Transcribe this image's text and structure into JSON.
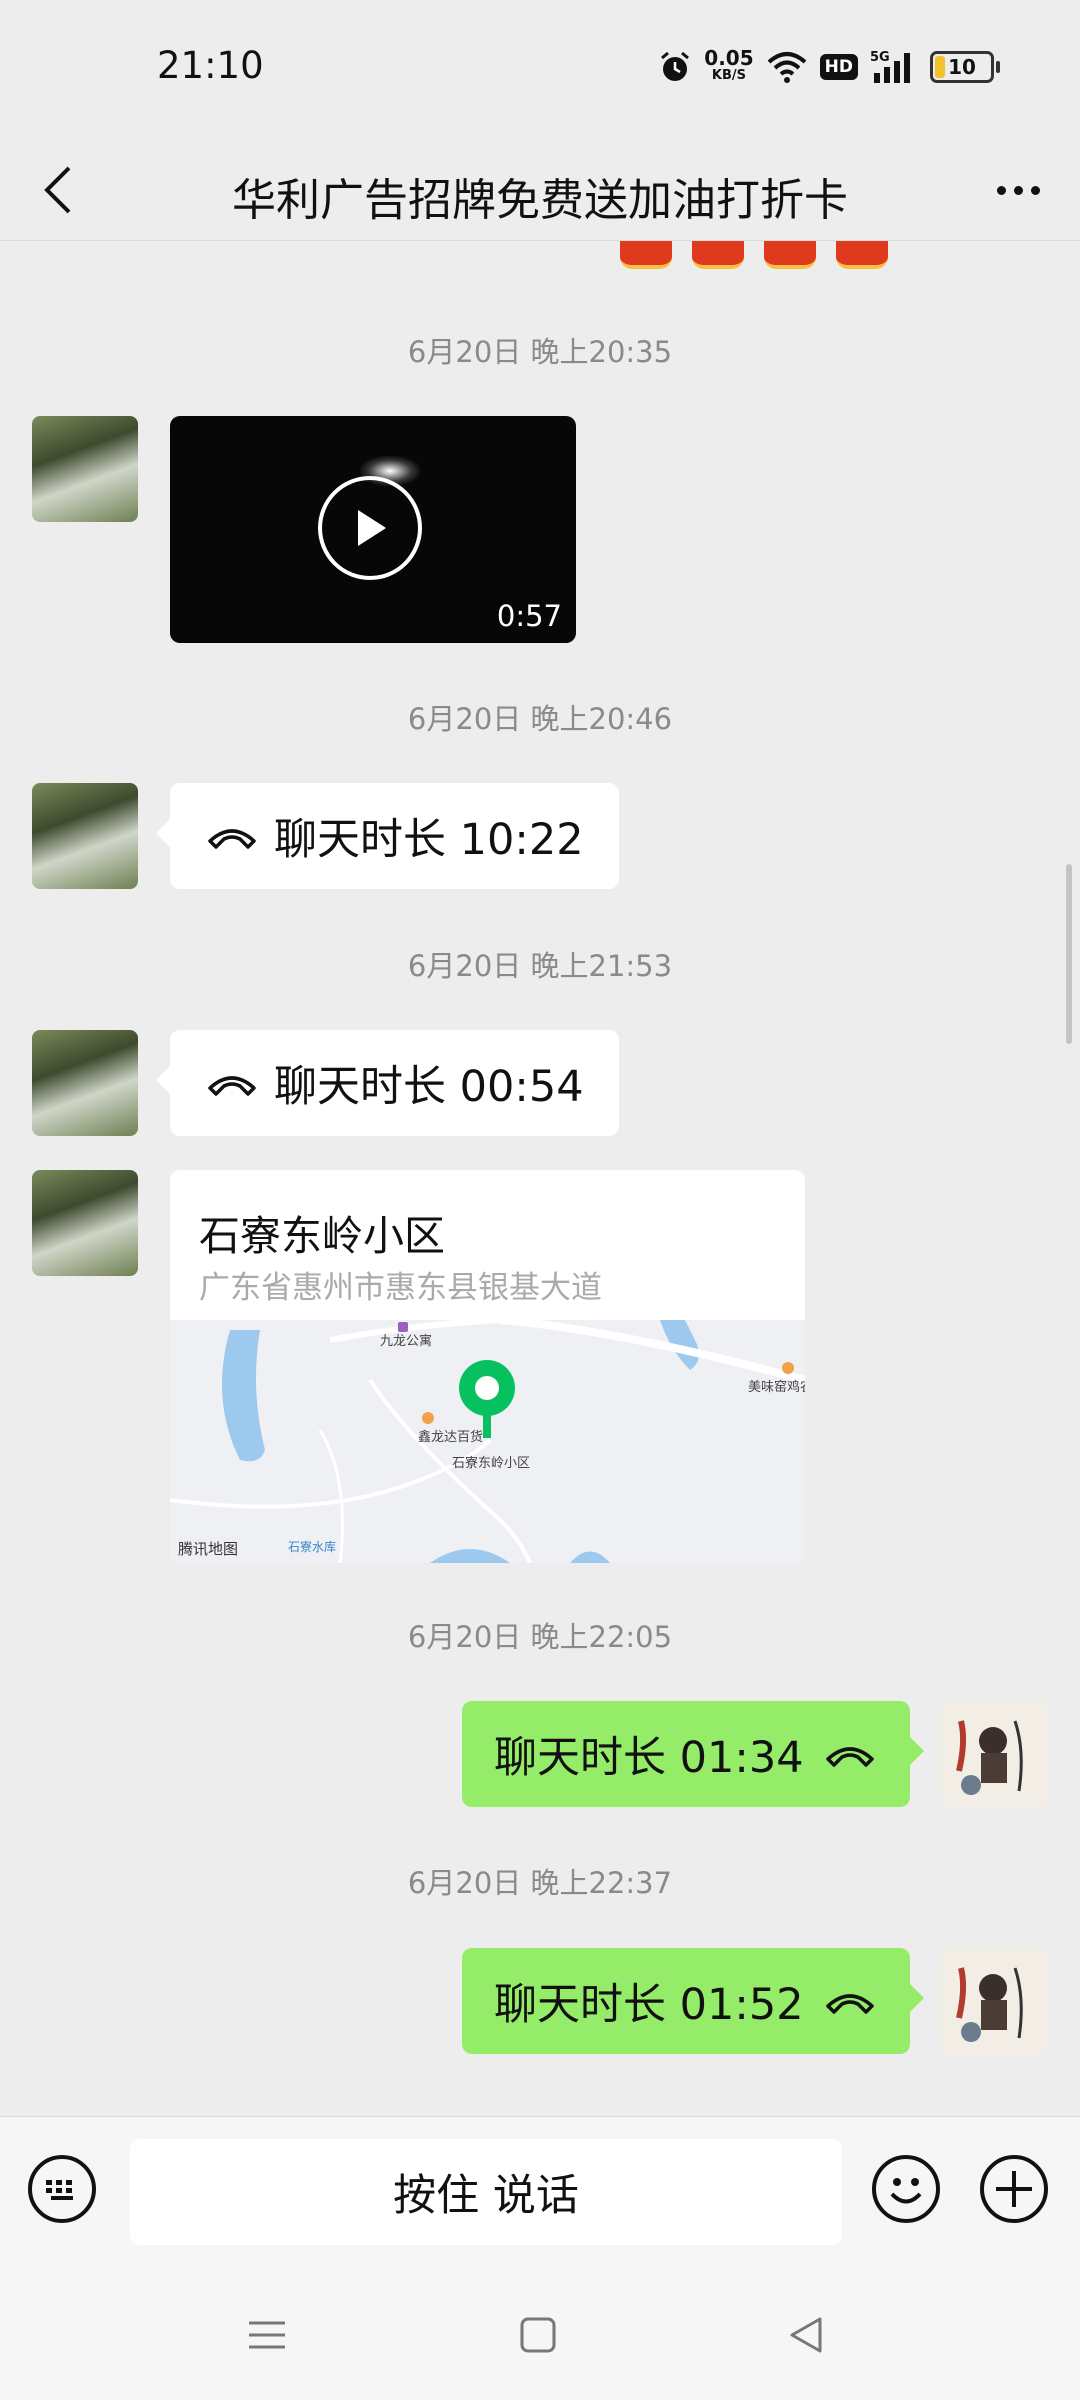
{
  "status_bar": {
    "time": "21:10",
    "net_speed_value": "0.05",
    "net_speed_unit": "KB/S",
    "hd_label": "HD",
    "signal_label": "5G",
    "battery_level": "10"
  },
  "header": {
    "title": "华利广告招牌免费送加油打折卡",
    "back_icon": "chevron-left-icon",
    "more_icon": "more-dots-icon"
  },
  "messages": {
    "ts1": "6月20日 晚上20:35",
    "video_duration": "0:57",
    "ts2": "6月20日 晚上20:46",
    "call1": "聊天时长 10:22",
    "ts3": "6月20日 晚上21:53",
    "call2": "聊天时长 00:54",
    "location": {
      "name": "石寮东岭小区",
      "address": "广东省惠州市惠东县银基大道",
      "map_labels": {
        "poi1": "九龙公寓",
        "poi2": "美味窑鸡农",
        "poi3": "鑫龙达百货",
        "pin_label": "石寮东岭小区",
        "reservoir": "石寮水库",
        "credit": "腾讯地图"
      }
    },
    "ts4": "6月20日 晚上22:05",
    "call3": "聊天时长 01:34",
    "ts5": "6月20日 晚上22:37",
    "call4": "聊天时长 01:52"
  },
  "input_bar": {
    "hold_to_talk": "按住 说话"
  },
  "colors": {
    "background": "#ededed",
    "sent_bubble": "#95ec69",
    "received_bubble": "#ffffff",
    "map_pin": "#07c160"
  }
}
